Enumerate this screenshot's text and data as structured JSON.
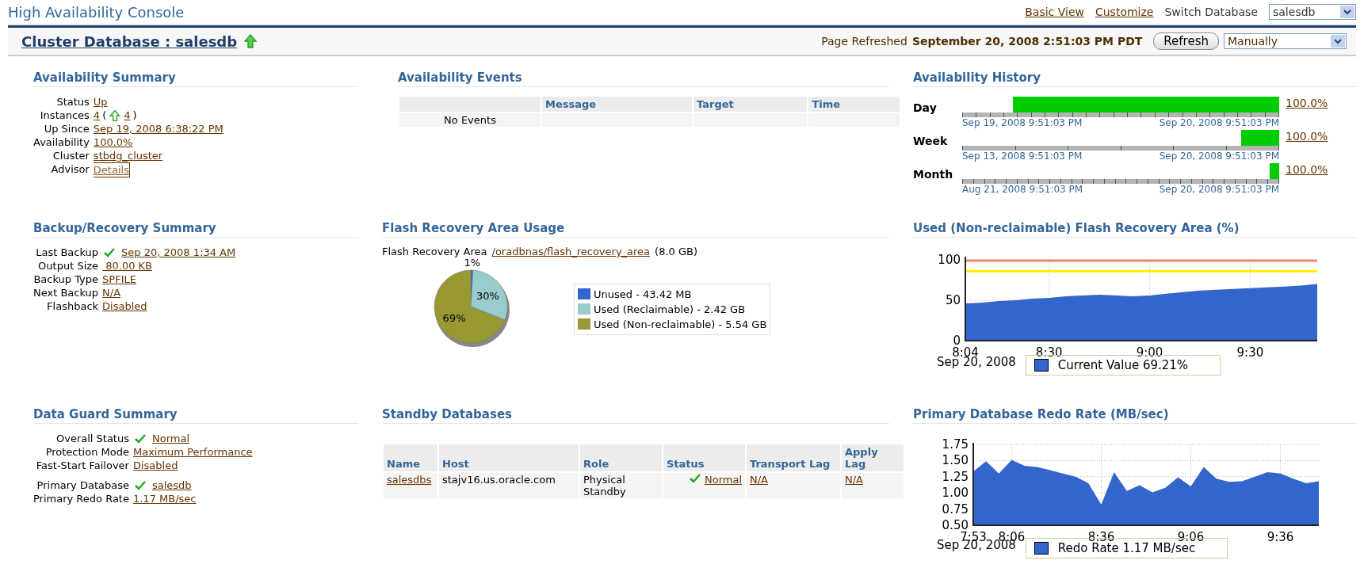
{
  "header": {
    "title": "High Availability Console",
    "links": [
      "Basic View",
      "Customize"
    ],
    "switch_label": "Switch Database",
    "switch_value": "salesdb"
  },
  "target_bar": {
    "title": "Cluster Database : salesdb",
    "refreshed_label": "Page Refreshed",
    "refreshed_time": "September 20, 2008 2:51:03 PM PDT",
    "refresh_button": "Refresh",
    "refresh_mode": "Manually"
  },
  "availability_summary": {
    "title": "Availability Summary",
    "rows": [
      {
        "label": "Status",
        "kind": "link",
        "value": "Up"
      },
      {
        "label": "Instances",
        "kind": "instances",
        "value": "4",
        "paren_open": "(",
        "count": "4",
        "paren_close": ")"
      },
      {
        "label": "Up Since",
        "kind": "link",
        "value": "Sep 19, 2008 6:38:22 PM"
      },
      {
        "label": "Availability",
        "kind": "link",
        "value": "100.0%"
      },
      {
        "label": "Cluster",
        "kind": "link",
        "value": "stbdg_cluster"
      },
      {
        "label": "Advisor",
        "kind": "focused",
        "value": "Details"
      }
    ]
  },
  "availability_events": {
    "title": "Availability Events",
    "columns": [
      "Message",
      "Target",
      "Time"
    ],
    "rows": [
      {
        "column_1": "No Events"
      }
    ]
  },
  "availability_history": {
    "title": "Availability History",
    "bars": [
      {
        "label": "Day",
        "level": 0.84,
        "start": "Sep 19, 2008 9:51:03 PM",
        "end": "Sep 20, 2008 9:51:03 PM",
        "percent": "100.0%"
      },
      {
        "label": "Week",
        "level": 0.12,
        "start": "Sep 13, 2008 9:51:03 PM",
        "end": "Sep 20, 2008 9:51:03 PM",
        "percent": "100.0%"
      },
      {
        "label": "Month",
        "level": 0.03,
        "start": "Aug 21, 2008 9:51:03 PM",
        "end": "Sep 20, 2008 9:51:03 PM",
        "percent": "100.0%"
      }
    ]
  },
  "backup_summary": {
    "title": "Backup/Recovery Summary",
    "rows": [
      {
        "label": "Last Backup",
        "kind": "check",
        "value": "Sep 20, 2008 1:34 AM"
      },
      {
        "label": "Output Size",
        "kind": "link",
        "value": " 80.00 KB"
      },
      {
        "label": "Backup Type",
        "kind": "link",
        "value": "SPFILE"
      },
      {
        "label": "Next Backup",
        "kind": "link",
        "value": "N/A"
      },
      {
        "label": "Flashback",
        "kind": "link",
        "value": "Disabled"
      }
    ]
  },
  "flash_usage": {
    "title": "Flash Recovery Area Usage",
    "area_label": "Flash Recovery Area",
    "area_path": "/oradbnas/flash_recovery_area",
    "area_size": "(8.0 GB)",
    "chart_data": {
      "type": "pie",
      "categories": [
        "Unused - 43.42 MB",
        "Used (Reclaimable) - 2.42 GB",
        "Used (Non-reclaimable) - 5.54 GB"
      ],
      "values": [
        1,
        30,
        69
      ],
      "value_labels": [
        "1%",
        "30%",
        "69%"
      ]
    },
    "legend": [
      {
        "color": "#3366cc"
      },
      {
        "color": "#99cccc"
      },
      {
        "color": "#999933"
      }
    ]
  },
  "flash_used_chart": {
    "title": "Used (Non-reclaimable) Flash Recovery Area (%)",
    "chart_data": {
      "type": "area",
      "xlabel": "Sep 20, 2008",
      "categories": [
        "8:04",
        null,
        null,
        null,
        null,
        "8:30",
        null,
        null,
        null,
        null,
        null,
        "9:00",
        null,
        null,
        null,
        null,
        null,
        "9:30",
        null,
        null,
        null,
        null
      ],
      "series": [
        {
          "name": "Current Value 69.21%",
          "color": "#3366cc",
          "values": [
            46,
            47,
            49,
            50,
            52,
            53,
            55,
            56,
            57,
            56,
            55,
            56,
            58,
            60,
            62,
            63,
            64,
            65,
            66,
            67,
            68,
            70
          ]
        }
      ],
      "ylim": [
        0,
        100
      ],
      "yticks": [
        0,
        50,
        100
      ],
      "grid": true,
      "ref_lines": [
        {
          "axis": "y",
          "value": 86,
          "color": "#ffee00"
        },
        {
          "axis": "y",
          "value": 99,
          "color": "#f08070"
        }
      ]
    }
  },
  "data_guard_summary": {
    "title": "Data Guard Summary",
    "rows": [
      {
        "label": "Overall Status",
        "kind": "check",
        "value": "Normal"
      },
      {
        "label": "Protection Mode",
        "kind": "link",
        "value": "Maximum Performance"
      },
      {
        "label": "Fast-Start Failover",
        "kind": "link",
        "value": "Disabled"
      },
      {
        "label": "Primary Database",
        "kind": "check",
        "value": "salesdb"
      },
      {
        "label": "Primary Redo Rate",
        "kind": "link",
        "value": "1.17 MB/sec"
      }
    ]
  },
  "standby_databases": {
    "title": "Standby Databases",
    "columns": [
      "Name",
      "Host",
      "Role",
      "Status",
      "Transport Lag",
      "Apply Lag"
    ],
    "rows": [
      {
        "name": "salesdbs",
        "host": "stajv16.us.oracle.com",
        "role": "Physical Standby",
        "status": "Normal",
        "transport_lag": "N/A",
        "apply_lag": "N/A"
      }
    ]
  },
  "redo_rate_chart": {
    "title": "Primary Database Redo Rate (MB/sec)",
    "chart_data": {
      "type": "area",
      "xlabel": "Sep 20, 2008",
      "categories": [
        "7:53",
        null,
        null,
        "8:06",
        null,
        null,
        null,
        null,
        null,
        null,
        "8:36",
        null,
        null,
        null,
        null,
        null,
        null,
        "9:06",
        null,
        null,
        null,
        null,
        null,
        null,
        "9:36",
        null,
        null,
        null
      ],
      "series": [
        {
          "name": "Redo Rate 1.17 MB/sec",
          "color": "#3366cc",
          "values": [
            1.33,
            1.49,
            1.3,
            1.51,
            1.42,
            1.4,
            1.35,
            1.3,
            1.25,
            1.15,
            0.82,
            1.32,
            1.03,
            1.12,
            1.01,
            1.08,
            1.24,
            1.1,
            1.4,
            1.22,
            1.17,
            1.18,
            1.25,
            1.32,
            1.3,
            1.22,
            1.15,
            1.18
          ]
        }
      ],
      "ylim": [
        0.5,
        1.75
      ],
      "grid": true,
      "yticks": [
        {
          "value": 0.5,
          "label": "0.50"
        },
        {
          "value": 0.75,
          "label": "0.75"
        },
        {
          "value": 1,
          "label": "1.00"
        },
        {
          "value": 1.25,
          "label": "1.25"
        },
        {
          "value": 1.5,
          "label": "1.50"
        },
        {
          "value": 1.75,
          "label": "1.75"
        }
      ]
    }
  }
}
